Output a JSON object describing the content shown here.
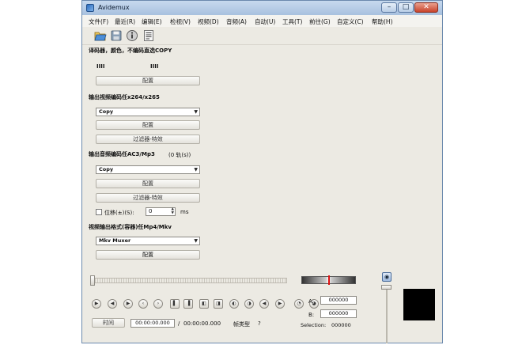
{
  "window": {
    "title": "Avidemux",
    "minimize_glyph": "–",
    "maximize_glyph": "□",
    "close_glyph": "✕"
  },
  "menu": [
    "文件(F)",
    "最近(R)",
    "编辑(E)",
    "检视(V)",
    "视频(D)",
    "音频(A)",
    "自动(U)",
    "工具(T)",
    "前往(G)",
    "自定义(C)",
    "帮助(H)"
  ],
  "toolbar": {
    "icons": [
      "open-folder-icon",
      "save-icon",
      "info-icon",
      "properties-icon"
    ]
  },
  "decoder": {
    "title": "译码器，颜色，不编码直选COPY",
    "video_label": "IIII",
    "audio_label": "IIII",
    "config_button": "配置"
  },
  "video_output": {
    "title": "输出视频编码任x264/x265",
    "codec_selected": "Copy",
    "config_button": "配置",
    "filters_button": "过滤器-特效"
  },
  "audio_output": {
    "title": "输出音频编码任AC3/Mp3",
    "track_note": "(0 轨(s))",
    "codec_selected": "Copy",
    "config_button": "配置",
    "filters_button": "过滤器-特效",
    "shift_label": "位移(±)(S):",
    "shift_value": "0",
    "shift_unit": "ms"
  },
  "format_output": {
    "title": "视频输出格式(容器)任Mp4/Mkv",
    "muxer_selected": "Mkv Muxer",
    "config_button": "配置"
  },
  "playback": {
    "position_fraction": 0.0,
    "time_button": "时间",
    "current_time": "00:00:00.000",
    "separator": "/",
    "total_time": "00:00:00.000",
    "frame_type_label": "帧类型",
    "frame_type_value": "?",
    "marker_a_label": "A:",
    "marker_a_value": "000000",
    "marker_b_label": "B:",
    "marker_b_value": "000000",
    "selection_label": "Selection:",
    "selection_value": "000000",
    "controls": [
      "play-icon",
      "rewind-icon",
      "fast-forward-icon",
      "previous-frame-icon",
      "next-frame-icon",
      "previous-keyframe-icon",
      "next-keyframe-icon",
      "set-marker-a-icon",
      "set-marker-b-icon",
      "previous-black-frame-icon",
      "next-black-frame-icon",
      "goto-first-frame-icon",
      "goto-last-frame-icon",
      "goto-marker-a-icon",
      "goto-marker-b-icon"
    ]
  }
}
